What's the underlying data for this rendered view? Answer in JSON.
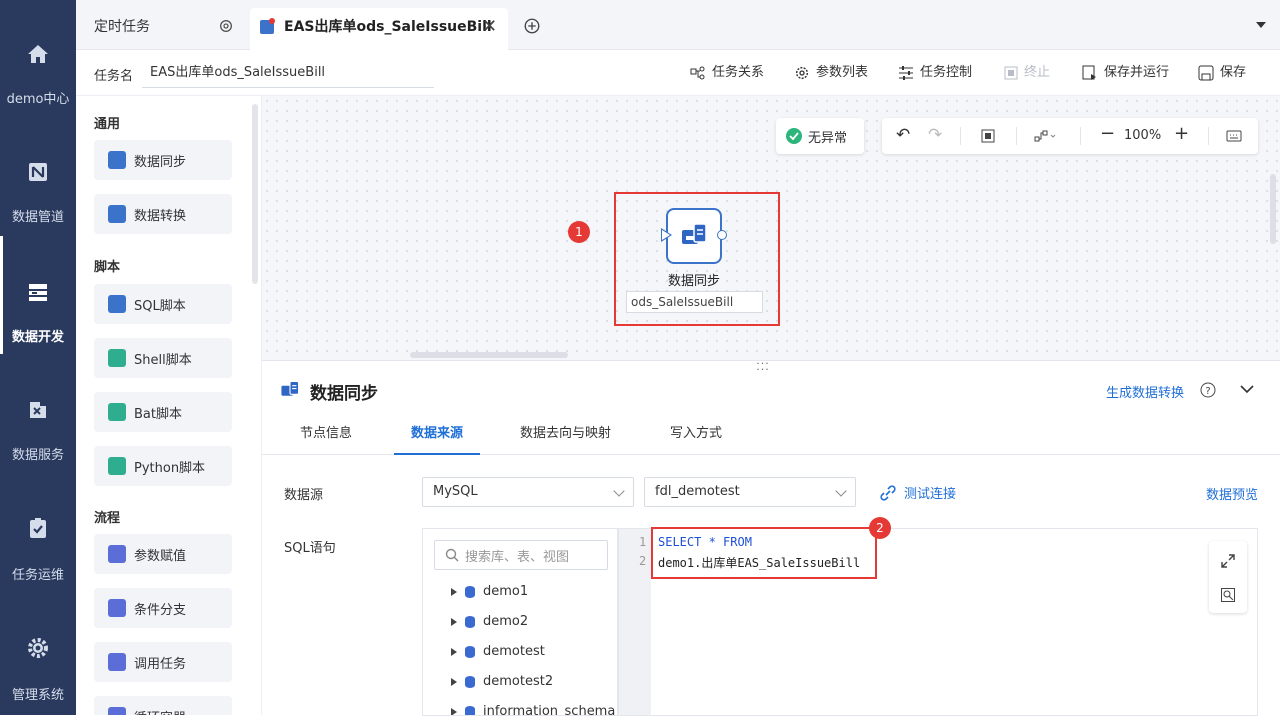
{
  "nav": {
    "items": [
      {
        "label": "demo中心",
        "icon": "home-icon"
      },
      {
        "label": "数据管道",
        "icon": "pipeline-icon"
      },
      {
        "label": "数据开发",
        "icon": "dev-icon"
      },
      {
        "label": "数据服务",
        "icon": "service-icon"
      },
      {
        "label": "任务运维",
        "icon": "ops-icon"
      },
      {
        "label": "管理系统",
        "icon": "gear-icon"
      }
    ],
    "active": "数据开发"
  },
  "tabs": {
    "tab1": "定时任务",
    "tab2": "EAS出库单ods_SaleIssueBill"
  },
  "header": {
    "task_name_label": "任务名",
    "task_name_value": "EAS出库单ods_SaleIssueBill",
    "tools": {
      "relation": "任务关系",
      "params": "参数列表",
      "control": "任务控制",
      "stop": "终止",
      "save_run": "保存并运行",
      "save": "保存"
    }
  },
  "panel": {
    "sections": {
      "general": "通用",
      "script": "脚本",
      "flow": "流程"
    },
    "general_items": [
      "数据同步",
      "数据转换"
    ],
    "script_items": [
      "SQL脚本",
      "Shell脚本",
      "Bat脚本",
      "Python脚本"
    ],
    "flow_items": [
      "参数赋值",
      "条件分支",
      "调用任务",
      "循环容器"
    ]
  },
  "canvas": {
    "status": "无异常",
    "zoom": "100%",
    "node_type": "数据同步",
    "node_name": "ods_SaleIssueBill",
    "marker1": "1",
    "marker2": "2"
  },
  "detail": {
    "title": "数据同步",
    "generate_link": "生成数据转换",
    "tabs": [
      "节点信息",
      "数据来源",
      "数据去向与映射",
      "写入方式"
    ],
    "active_tab": "数据来源",
    "datasource_label": "数据源",
    "datasource_type": "MySQL",
    "datasource_name": "fdl_demotest",
    "test_connection": "测试连接",
    "preview": "数据预览",
    "sql_label": "SQL语句",
    "search_placeholder": "搜索库、表、视图",
    "tree": [
      "demo1",
      "demo2",
      "demotest",
      "demotest2",
      "information_schema"
    ],
    "sql_lines": [
      "SELECT * FROM",
      "demo1.出库单EAS_SaleIssueBill"
    ],
    "line_numbers": [
      "1",
      "2"
    ]
  },
  "colors": {
    "nav_bg": "#2a3a5e",
    "accent": "#1f6fd6",
    "highlight_red": "#e53935",
    "ok_green": "#2db67c"
  }
}
